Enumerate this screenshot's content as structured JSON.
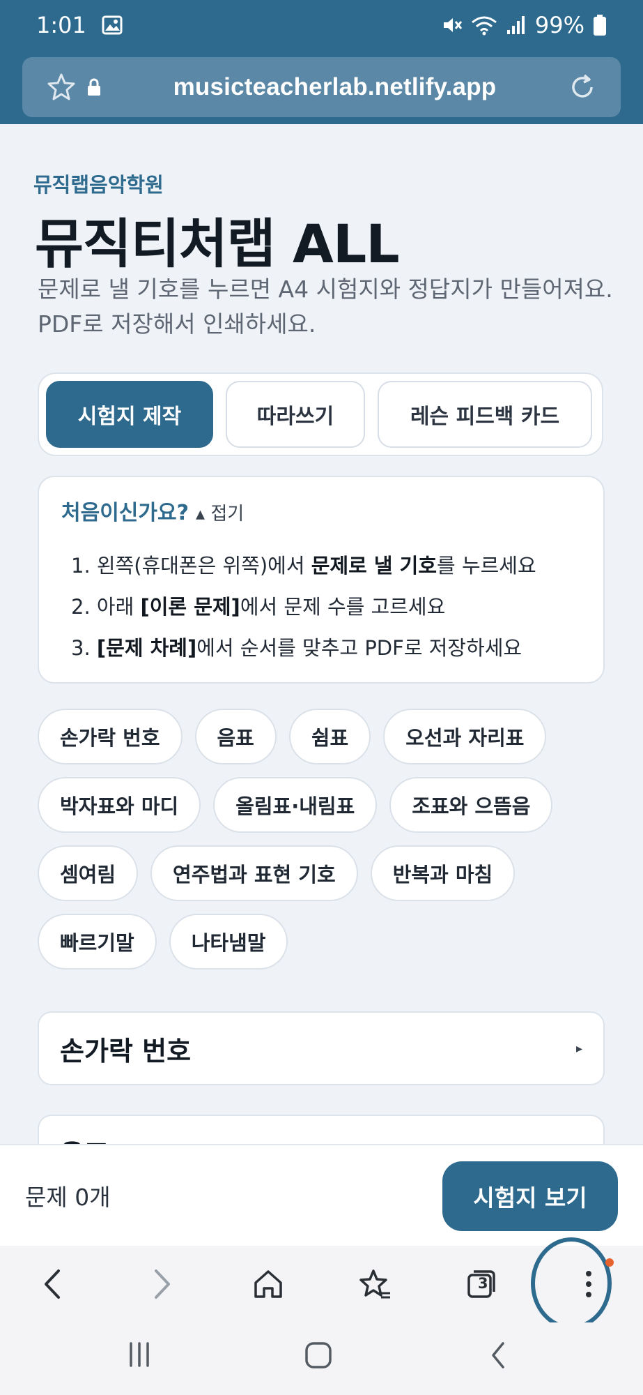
{
  "status": {
    "time": "1:01",
    "battery": "99%"
  },
  "browser": {
    "url": "musicteacherlab.netlify.app",
    "tab_count": "3"
  },
  "page": {
    "eyebrow": "뮤직랩음악학원",
    "title": "뮤직티처랩 ALL",
    "subtitle": "문제로 낼 기호를 누르면 A4 시험지와 정답지가 만들어져요. PDF로 저장해서 인쇄하세요."
  },
  "tabs": [
    {
      "label": "시험지 제작",
      "active": true
    },
    {
      "label": "따라쓰기",
      "active": false
    },
    {
      "label": "레슨 피드백 카드",
      "active": false
    }
  ],
  "help": {
    "title": "처음이신가요?",
    "toggle": "▴ 접기",
    "steps": [
      {
        "num": "1.",
        "pre": "왼쪽(휴대폰은 위쪽)에서 ",
        "bold": "문제로 낼 기호",
        "post": "를 누르세요"
      },
      {
        "num": "2.",
        "pre": "아래 ",
        "bold": "[이론 문제]",
        "post": "에서 문제 수를 고르세요"
      },
      {
        "num": "3.",
        "pre": "",
        "bold": "[문제 차례]",
        "post": "에서 순서를 맞추고 PDF로 저장하세요"
      }
    ]
  },
  "chips": [
    "손가락 번호",
    "음표",
    "쉼표",
    "오선과 자리표",
    "박자표와 마디",
    "올림표·내림표",
    "조표와 으뜸음",
    "셈여림",
    "연주법과 표현 기호",
    "반복과 마침",
    "빠르기말",
    "나타냄말"
  ],
  "sections": [
    {
      "title": "손가락 번호",
      "arrow": "▸"
    },
    {
      "title": "음표",
      "arrow": "▸"
    }
  ],
  "action_bar": {
    "count": "문제 0개",
    "button": "시험지 보기"
  },
  "colors": {
    "primary": "#2d6a8e",
    "background": "#eff3f7"
  }
}
